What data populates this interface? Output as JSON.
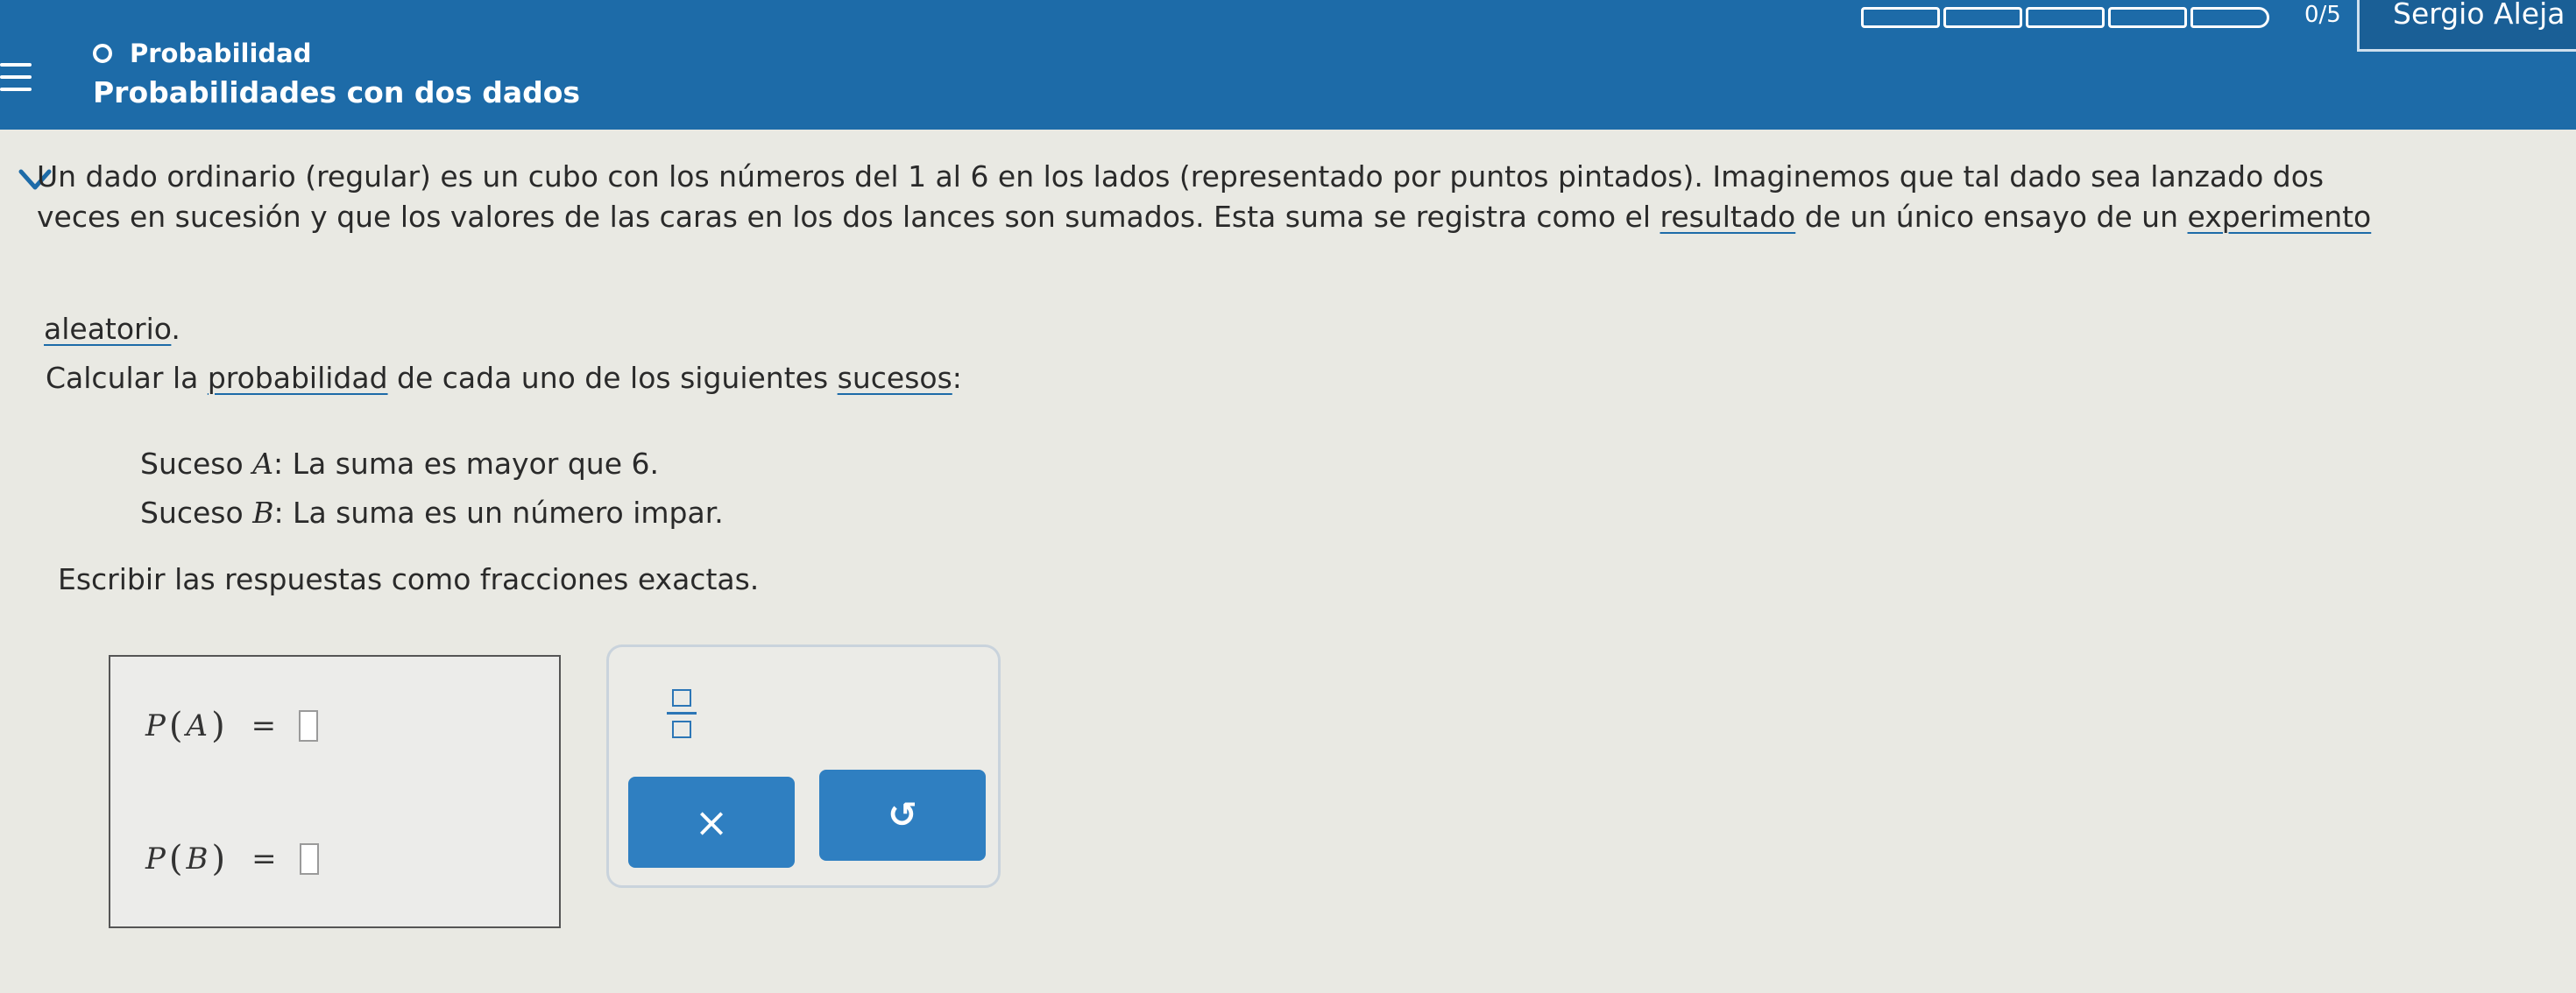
{
  "header": {
    "topic": "Probabilidad",
    "title": "Probabilidades con dos dados",
    "progress_count": "0/5",
    "user_name": "Sergio Aleja"
  },
  "problem": {
    "intro_line1": "Un dado ordinario (regular) es un cubo con los números del 1 al 6 en los lados (representado por puntos pintados). Imaginemos que tal dado sea lanzado dos",
    "intro_line2_pre": "veces en sucesión y que los valores de las caras en los dos lances son sumados. Esta suma se registra como el ",
    "intro_link_resultado": "resultado",
    "intro_line2_mid": " de un único ensayo de un ",
    "intro_link_experimento": "experimento",
    "intro_link_aleatorio": "aleatorio",
    "intro_line3_post": ".",
    "calc_pre": "Calcular la ",
    "calc_link_probabilidad": "probabilidad",
    "calc_mid": " de cada uno de los siguientes ",
    "calc_link_sucesos": "sucesos",
    "calc_post": ":",
    "event_a_prefix": "Suceso ",
    "event_a_var": "A",
    "event_a_text": ": La suma es mayor que 6.",
    "event_b_prefix": "Suceso ",
    "event_b_var": "B",
    "event_b_text": ": La suma es un número impar.",
    "instruction": "Escribir las respuestas como fracciones exactas."
  },
  "answers": {
    "p_symbol": "P",
    "a_var": "A",
    "b_var": "B",
    "lparen": "(",
    "rparen": ")",
    "equals": "=",
    "a_value": "",
    "b_value": ""
  },
  "toolbox": {
    "clear_symbol": "×",
    "undo_symbol": "↺"
  },
  "colors": {
    "header_bg": "#1d6ba8",
    "link_underline": "#1d6ba8",
    "button_bg": "#2f7fc1"
  }
}
